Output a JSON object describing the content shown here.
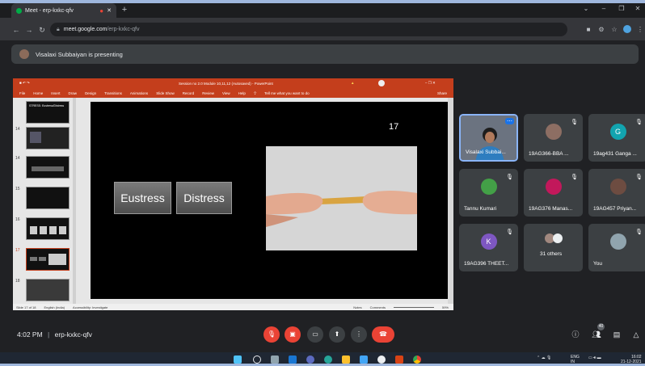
{
  "browser": {
    "tab_title": "Meet - erp-kxkc-qfv",
    "new_tab": "+",
    "url_host": "meet.google.com",
    "url_path": "/erp-kxkc-qfv",
    "controls": {
      "chevron": "⌄",
      "minimize": "–",
      "restore": "❐",
      "close": "✕"
    }
  },
  "presenting": {
    "text": "Visalaxi Subbaiyan is presenting"
  },
  "powerpoint": {
    "title": "Session no 2.0 Module 10,11,12 (Autosaved) - PowerPoint",
    "tell_me": "Tell me what you want to do",
    "share": "Share",
    "menu": [
      "File",
      "Home",
      "Insert",
      "Draw",
      "Design",
      "Transitions",
      "Animations",
      "Slide Show",
      "Record",
      "Review",
      "View",
      "Help"
    ],
    "thumb_title": "STRESS: Eustress/Distress",
    "thumbs": [
      "14",
      "14",
      "15",
      "16",
      "17",
      "18"
    ],
    "status_left": "Slide 17 of 18",
    "status_lang": "English (India)",
    "status_access": "Accessibility: Investigate",
    "status_notes": "Notes",
    "status_comments": "Comments",
    "zoom": "59%",
    "slide": {
      "number": "17",
      "box1": "Eustress",
      "box2": "Distress"
    }
  },
  "participants": [
    {
      "name": "Visalaxi Subbai...",
      "type": "video",
      "muted": false
    },
    {
      "name": "19AG366-BBA ...",
      "type": "avatar",
      "initial": "",
      "color": "#8d6e63",
      "muted": true
    },
    {
      "name": "19ag431 Ganga ...",
      "type": "avatar",
      "initial": "G",
      "color": "#12a4af",
      "muted": true
    },
    {
      "name": "Tannu Kumari",
      "type": "avatar",
      "initial": "",
      "color": "#43a047",
      "muted": true
    },
    {
      "name": "19AG376 Manas...",
      "type": "avatar",
      "initial": "",
      "color": "#c2185b",
      "muted": true
    },
    {
      "name": "19AG457 Priyan...",
      "type": "avatar",
      "initial": "",
      "color": "#6d4c41",
      "muted": true
    },
    {
      "name": "19AG396 THEET...",
      "type": "avatar",
      "initial": "K",
      "color": "#7e57c2",
      "muted": true
    },
    {
      "name": "31 others",
      "type": "group",
      "muted": false
    },
    {
      "name": "You",
      "type": "avatar",
      "initial": "",
      "color": "#90a4ae",
      "muted": true
    }
  ],
  "meetbar": {
    "time": "4:02 PM",
    "separator": "|",
    "code": "erp-kxkc-qfv",
    "people_count": "40"
  },
  "taskbar": {
    "lang": "ENG",
    "lang2": "IN",
    "clock_time": "16:02",
    "clock_date": "21-12-2021"
  },
  "colors": {
    "ppt_accent": "#c43e1c",
    "meet_red": "#ea4335",
    "tile_bg": "#3c4043",
    "active_border": "#8ab4f8"
  }
}
